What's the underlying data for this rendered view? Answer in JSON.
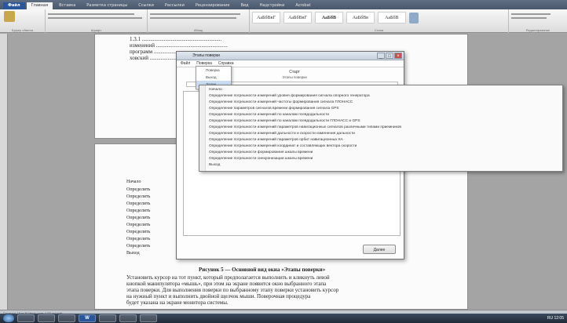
{
  "ribbon": {
    "tabs": [
      "Файл",
      "Главная",
      "Вставка",
      "Разметка страницы",
      "Ссылки",
      "Рассылки",
      "Рецензирование",
      "Вид",
      "Надстройки",
      "Acrobat"
    ],
    "groups": [
      "Буфер обмена",
      "Шрифт",
      "Абзац",
      "Стили",
      "Редактирование"
    ],
    "styles": [
      "АаБбВвГ",
      "АаБбВвГ",
      "АаБбВ",
      "АаБбВв",
      "АаБбВ"
    ]
  },
  "document": {
    "page1_lines": [
      "1.3.1 ..........................................................",
      "изменений ....................................................",
      "программ .......................................................",
      "ховский ..........................................................."
    ],
    "page2_list": [
      "Начало",
      "Определить",
      "Определить",
      "Определить",
      "Определить",
      "Определить",
      "Определить",
      "Определить",
      "Определить",
      "Определить",
      "Выход"
    ],
    "caption": "Рисунок 5 — Основной вид окна «Этапы поверки»",
    "body_lines": [
      "Установить курсор на тот пункт, который предполагается выполнить и кликнуть левой",
      "кнопкой манипулятора «мышь», при этом на экране появится окно выбранного этапа",
      "этапа поверки. Для выполнения поверки по выбранному этапу поверки установить курсор",
      "на нужный пункт и выполнить двойной щелчок мыши. Поверочная процедура",
      "будет указана на экране монитора системы."
    ]
  },
  "dialog": {
    "title": "Этапы поверки",
    "controls": [
      "_",
      "□",
      "×"
    ],
    "menu": [
      "Файл",
      "Поверка",
      "Справка"
    ],
    "heading": "Старт",
    "subheading": "Этапы поверки",
    "dropdown": [
      "Поверка",
      "Выход",
      "Далее"
    ],
    "ok_label": "Далее"
  },
  "submenu": {
    "items": [
      "Начало",
      "Определение погрешности измерений уровня формирования сигнала опорного генератора",
      "Определение погрешности измерений частоты формирования сигнала ГЛОНАСС",
      "Определение параметров сигналов времени формирования сигнала GPS",
      "Определение погрешности измерений по каналам псевдодальности",
      "Определение погрешности измерений по каналам псевдодальности ГЛОНАСС и GPS",
      "Определение погрешности измерений параметров навигационных сигналов различными типами приемников",
      "Определение погрешности измерений дальности и скорости изменения дальности",
      "Определение погрешности измерений параметров орбит навигационных КА",
      "Определение погрешности измерений координат и составляющих вектора скорости",
      "Определение погрешности формирования шкалы времени",
      "Определение погрешности синхронизации шкалы времени",
      "Выход"
    ]
  },
  "statusbar": {
    "text": "Страница: 18 из 26   Число слов: 4 731   русский"
  },
  "taskbar": {
    "apps": [
      "",
      "",
      "",
      "W",
      "",
      "",
      ""
    ],
    "tray_text": "RU  12:05"
  },
  "colors": {
    "word_blue": "#2b579a",
    "highlight": "#c9dcf2",
    "taskbar": "#2a3546"
  }
}
